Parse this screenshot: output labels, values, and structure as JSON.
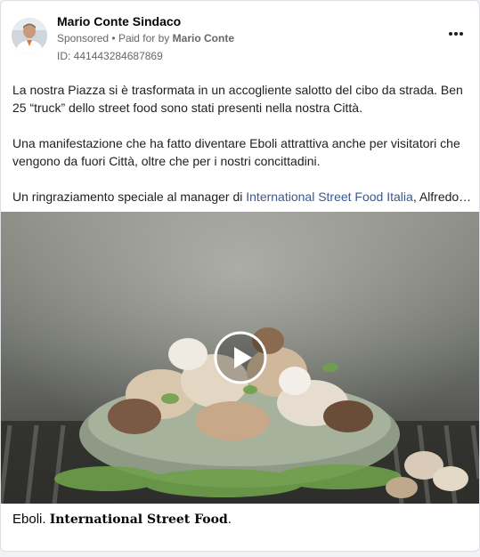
{
  "post": {
    "author": "Mario Conte Sindaco",
    "sponsored_label": "Sponsored",
    "separator": "•",
    "paid_for_prefix": "Paid for by",
    "paid_for_name": "Mario Conte",
    "ad_id": "ID: 441443284687869",
    "more_icon": "more-horizontal-icon",
    "paragraphs": {
      "p1": "La nostra Piazza si è trasformata in un accogliente salotto del cibo da strada. Ben 25 “truck” dello street food sono stati presenti nella nostra Città.",
      "p2": "Una manifestazione che ha fatto diventare Eboli attrattiva anche per visitatori che vengono da fuori Città, oltre che per i nostri concittadini.",
      "p3_prefix": "Un ringraziamento speciale al manager di ",
      "p3_link": "International Street Food Italia",
      "p3_suffix": ", Alfredo…"
    },
    "video": {
      "play_icon": "play-icon",
      "description": "video thumbnail"
    },
    "caption": {
      "prefix": "Eboli. ",
      "styled": "International Street Food",
      "suffix": "."
    }
  },
  "colors": {
    "link": "#385898",
    "meta_text": "#65676b",
    "body_text": "#1c1e21"
  }
}
